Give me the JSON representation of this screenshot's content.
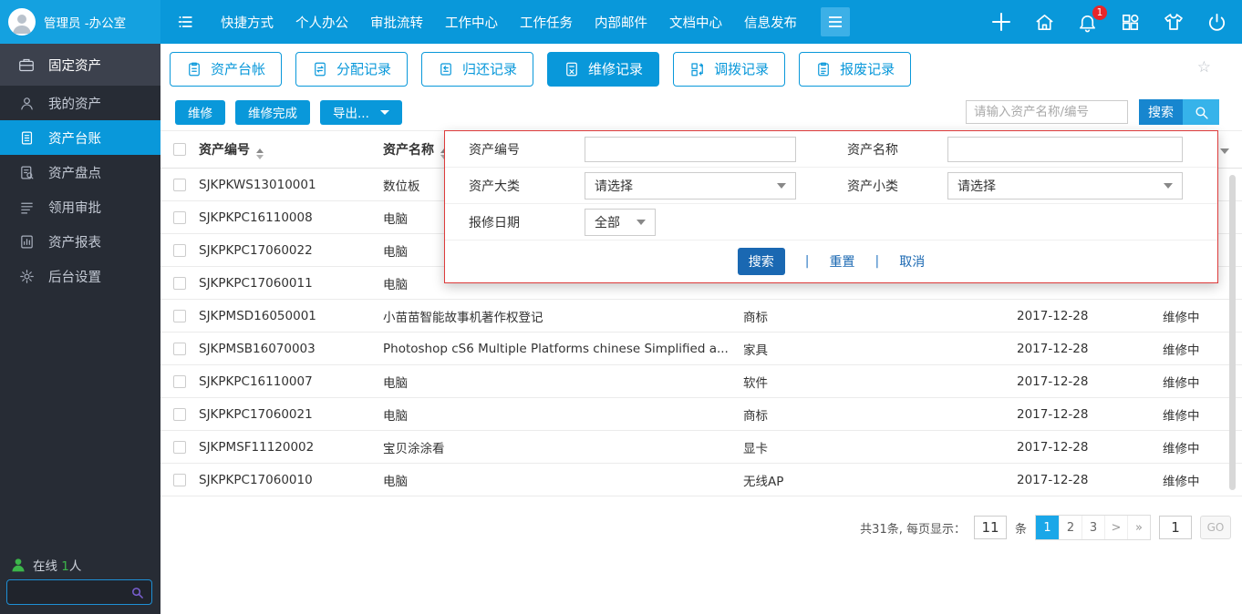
{
  "topbar": {
    "user_name": "管理员 -办公室",
    "menu": [
      "快捷方式",
      "个人办公",
      "审批流转",
      "工作中心",
      "工作任务",
      "内部邮件",
      "文档中心",
      "信息发布"
    ],
    "notification_count": "1"
  },
  "sidebar": {
    "module_title": "固定资产",
    "module_icon": "briefcase-icon",
    "items": [
      {
        "label": "我的资产",
        "icon": "person-icon",
        "active": false
      },
      {
        "label": "资产台账",
        "icon": "ledger-icon",
        "active": true
      },
      {
        "label": "资产盘点",
        "icon": "inventory-icon",
        "active": false
      },
      {
        "label": "领用审批",
        "icon": "approval-icon",
        "active": false
      },
      {
        "label": "资产报表",
        "icon": "report-icon",
        "active": false
      },
      {
        "label": "后台设置",
        "icon": "gear-icon",
        "active": false
      }
    ],
    "online_label": "在线",
    "online_count": "1",
    "online_unit": "人"
  },
  "tabs": [
    {
      "label": "资产台帐",
      "icon": "ledger-tab-icon",
      "active": false
    },
    {
      "label": "分配记录",
      "icon": "assign-icon",
      "active": false
    },
    {
      "label": "归还记录",
      "icon": "return-icon",
      "active": false
    },
    {
      "label": "维修记录",
      "icon": "repair-icon",
      "active": true
    },
    {
      "label": "调拨记录",
      "icon": "transfer-icon",
      "active": false
    },
    {
      "label": "报废记录",
      "icon": "scrap-icon",
      "active": false
    }
  ],
  "toolbar": {
    "repair_label": "维修",
    "repair_done_label": "维修完成",
    "export_label": "导出...",
    "search_placeholder": "请输入资产名称/编号",
    "search_label": "搜索"
  },
  "filter_popup": {
    "code_label": "资产编号",
    "code_value": "",
    "name_label": "资产名称",
    "name_value": "",
    "major_label": "资产大类",
    "major_value": "请选择",
    "minor_label": "资产小类",
    "minor_value": "请选择",
    "date_label": "报修日期",
    "date_value": "全部",
    "search_label": "搜索",
    "reset_label": "重置",
    "cancel_label": "取消"
  },
  "table": {
    "headers": {
      "code": "资产编号",
      "name": "资产名称"
    },
    "rows": [
      {
        "code": "SJKPKWS13010001",
        "name": "数位板",
        "category": "",
        "date": "",
        "status": ""
      },
      {
        "code": "SJKPKPC16110008",
        "name": "电脑",
        "category": "",
        "date": "",
        "status": ""
      },
      {
        "code": "SJKPKPC17060022",
        "name": "电脑",
        "category": "",
        "date": "",
        "status": ""
      },
      {
        "code": "SJKPKPC17060011",
        "name": "电脑",
        "category": "",
        "date": "",
        "status": ""
      },
      {
        "code": "SJKPMSD16050001",
        "name": "小苗苗智能故事机著作权登记",
        "category": "商标",
        "date": "2017-12-28",
        "status": "维修中"
      },
      {
        "code": "SJKPMSB16070003",
        "name": "Photoshop cS6 Multiple Platforms chinese Simplified a...",
        "category": "家具",
        "date": "2017-12-28",
        "status": "维修中"
      },
      {
        "code": "SJKPKPC16110007",
        "name": "电脑",
        "category": "软件",
        "date": "2017-12-28",
        "status": "维修中"
      },
      {
        "code": "SJKPKPC17060021",
        "name": "电脑",
        "category": "商标",
        "date": "2017-12-28",
        "status": "维修中"
      },
      {
        "code": "SJKPMSF11120002",
        "name": "宝贝涂涂看",
        "category": "显卡",
        "date": "2017-12-28",
        "status": "维修中"
      },
      {
        "code": "SJKPKPC17060010",
        "name": "电脑",
        "category": "无线AP",
        "date": "2017-12-28",
        "status": "维修中"
      }
    ]
  },
  "pagination": {
    "summary": "共31条, 每页显示：",
    "page_size": "11",
    "unit": "条",
    "pages": [
      "1",
      "2",
      "3"
    ],
    "active_page": "1",
    "next": ">",
    "last": "»",
    "goto_value": "1",
    "go_label": "GO"
  },
  "colors": {
    "topbar_blue": "#0998da",
    "accent_blue": "#0998da",
    "search_button_blue": "#1786cf",
    "popup_button_blue": "#1a68b2",
    "popup_border_red": "#dd3b3b",
    "pagination_active_blue": "#1aa7e8",
    "online_green": "#3cb54a",
    "badge_red": "#e8262a"
  }
}
